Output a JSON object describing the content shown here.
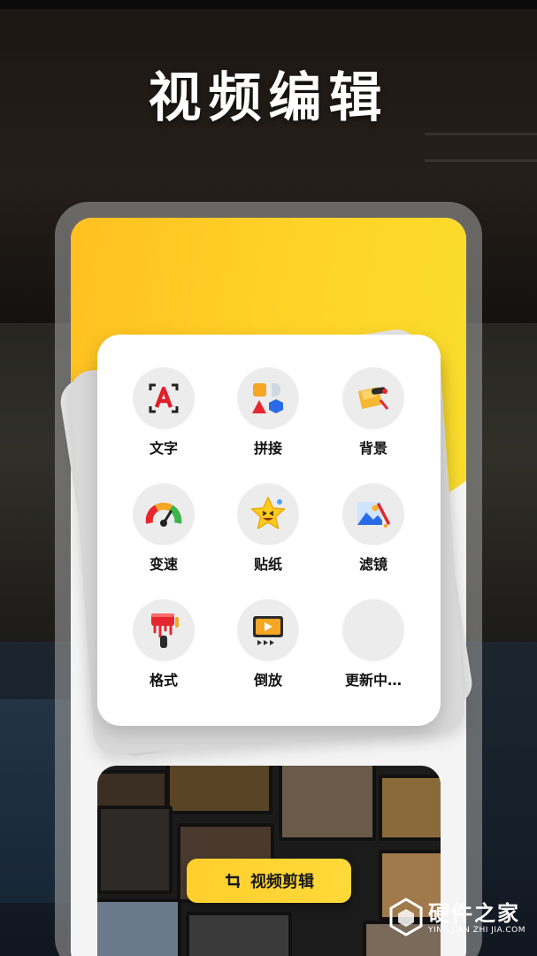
{
  "header": {
    "title": "视频编辑"
  },
  "tools": [
    {
      "label": "文字",
      "icon": "text-icon"
    },
    {
      "label": "拼接",
      "icon": "shapes-icon"
    },
    {
      "label": "背景",
      "icon": "paint-roller-icon"
    },
    {
      "label": "变速",
      "icon": "speedometer-icon"
    },
    {
      "label": "贴纸",
      "icon": "star-sticker-icon"
    },
    {
      "label": "滤镜",
      "icon": "image-filter-icon"
    },
    {
      "label": "格式",
      "icon": "paint-brush-icon"
    },
    {
      "label": "倒放",
      "icon": "reverse-play-icon"
    },
    {
      "label": "更新中…",
      "icon": ""
    }
  ],
  "preview": {
    "button_label": "视频剪辑",
    "button_icon": "crop-icon"
  },
  "watermark": {
    "name": "硬件之家",
    "sub": "YING JIAN ZHI JIA.COM"
  },
  "colors": {
    "accent": "#ffd23a",
    "card": "#ffffff",
    "icon_bg": "#ececec"
  }
}
